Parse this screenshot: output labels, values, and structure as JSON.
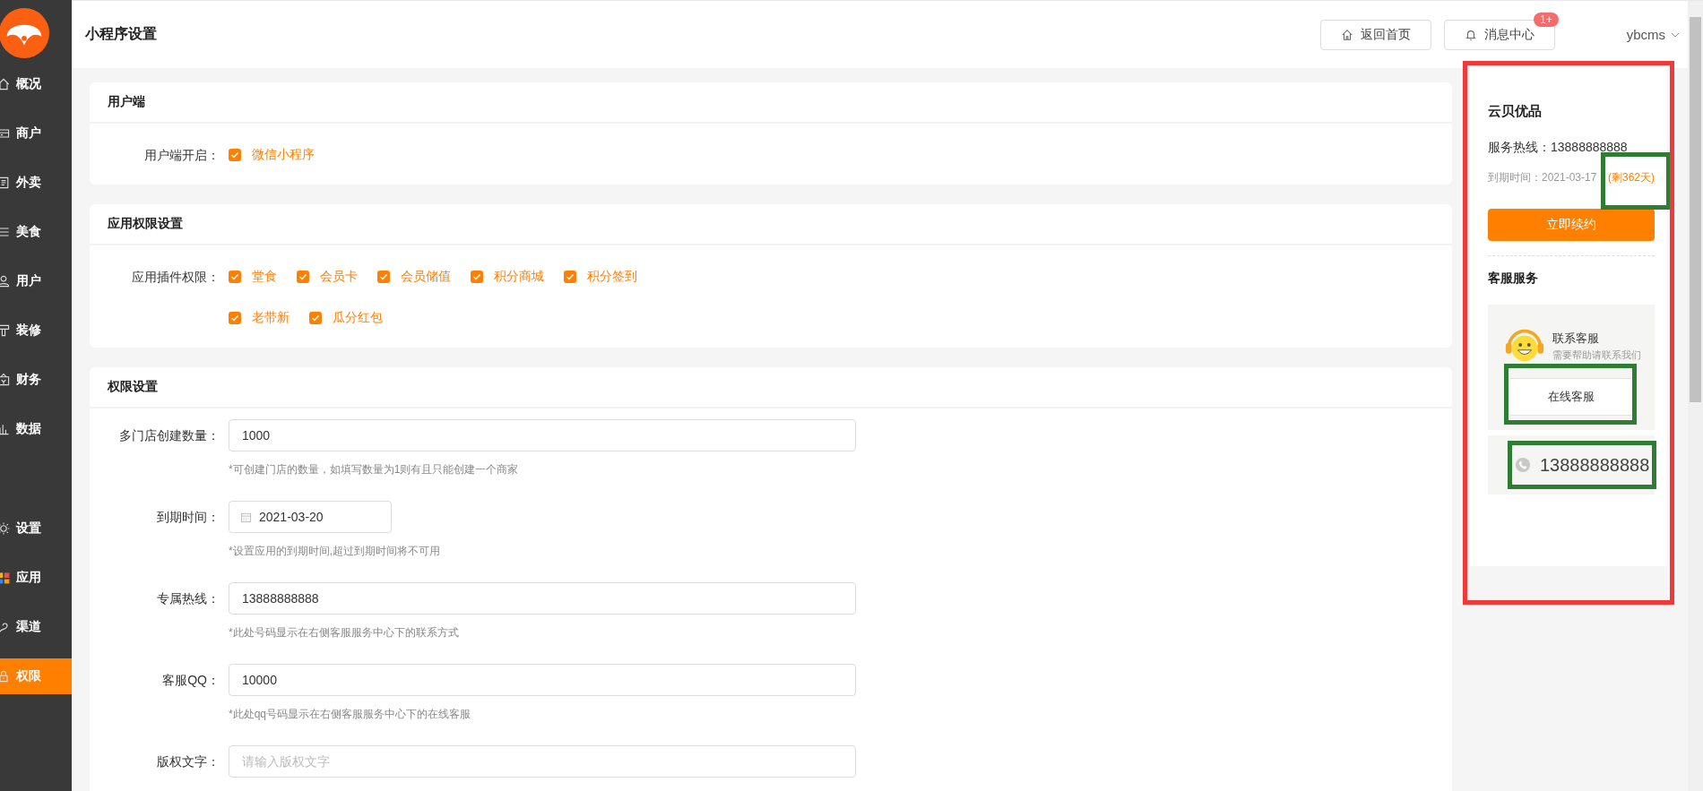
{
  "header": {
    "page_title": "小程序设置",
    "buttons": [
      {
        "label": "返回首页",
        "kind": "home"
      },
      {
        "label": "消息中心",
        "kind": "bell",
        "badge": "1+"
      }
    ],
    "user": "ybcms"
  },
  "sidebar": {
    "items": [
      {
        "label": "概况",
        "selected": false
      },
      {
        "label": "商户",
        "selected": false
      },
      {
        "label": "外卖",
        "selected": false
      },
      {
        "label": "美食",
        "selected": false
      },
      {
        "label": "用户",
        "selected": false
      },
      {
        "label": "装修",
        "selected": false
      },
      {
        "label": "财务",
        "selected": false
      },
      {
        "label": "数据",
        "selected": false
      }
    ],
    "bottom_items": [
      {
        "label": "设置",
        "selected": false
      },
      {
        "label": "应用",
        "selected": false
      },
      {
        "label": "渠道",
        "selected": false
      },
      {
        "label": "权限",
        "selected": true
      }
    ]
  },
  "sections": [
    {
      "title": "用户端",
      "rows": [
        {
          "kind": "checks",
          "label": "用户端开启：",
          "options": [
            {
              "label": "微信小程序",
              "checked": true
            }
          ]
        }
      ]
    },
    {
      "title": "应用权限设置",
      "rows": [
        {
          "kind": "checks",
          "label": "应用插件权限：",
          "options": [
            {
              "label": "堂食",
              "checked": true
            },
            {
              "label": "会员卡",
              "checked": true
            },
            {
              "label": "会员储值",
              "checked": true
            },
            {
              "label": "积分商城",
              "checked": true
            },
            {
              "label": "积分签到",
              "checked": true
            },
            {
              "label": "老带新",
              "checked": true
            },
            {
              "label": "瓜分红包",
              "checked": true
            }
          ]
        }
      ]
    },
    {
      "title": "权限设置",
      "rows": [
        {
          "kind": "input",
          "label": "多门店创建数量：",
          "value": "1000",
          "hint": "*可创建门店的数量，如填写数量为1则有且只能创建一个商家"
        },
        {
          "kind": "date",
          "label": "到期时间：",
          "value": "2021-03-20",
          "hint": "*设置应用的到期时间,超过到期时间将不可用"
        },
        {
          "kind": "input",
          "label": "专属热线：",
          "value": "13888888888",
          "hint": "*此处号码显示在右侧客服服务中心下的联系方式"
        },
        {
          "kind": "input",
          "label": "客服QQ：",
          "value": "10000",
          "hint": "*此处qq号码显示在右侧客服服务中心下的在线客服"
        },
        {
          "kind": "input",
          "label": "版权文字：",
          "placeholder": "请输入版权文字"
        }
      ]
    }
  ],
  "panel": {
    "shop_name": "云贝优品",
    "hotline": "服务热线：13888888888",
    "expiry": "到期时间：2021-03-17",
    "remaining": "(剩362天)",
    "renew_button": "立即续约",
    "service_title": "客服服务",
    "contact_title": "联系客服",
    "contact_subtitle": "需要帮助请联系我们",
    "online_button": "在线客服",
    "phone": "13888888888"
  }
}
